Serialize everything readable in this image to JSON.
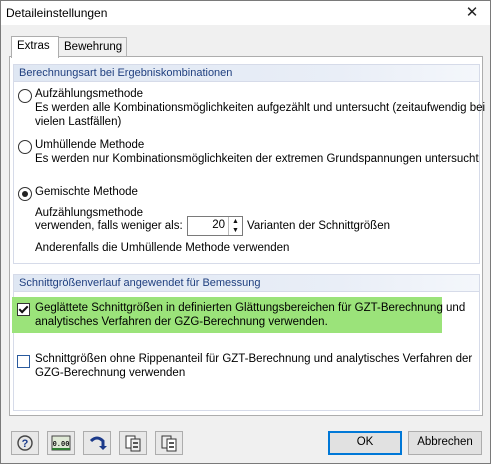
{
  "window": {
    "title": "Detaileinstellungen"
  },
  "tabs": [
    {
      "label": "Extras",
      "active": true
    },
    {
      "label": "Bewehrung",
      "active": false
    }
  ],
  "group1": {
    "title": "Berechnungsart bei Ergebniskombinationen",
    "opt1": {
      "label": "Aufzählungsmethode",
      "desc1": "Es werden alle Kombinationsmöglichkeiten aufgezählt und untersucht (zeitaufwendig bei",
      "desc2": "vielen Lastfällen)"
    },
    "opt2": {
      "label": "Umhüllende Methode",
      "desc1": "Es werden nur Kombinationsmöglichkeiten der extremen Grundspannungen untersucht"
    },
    "opt3": {
      "label": "Gemischte Methode",
      "line1": "Aufzählungsmethode",
      "line2": "verwenden, falls weniger als:",
      "value": "20",
      "after": "Varianten der Schnittgrößen",
      "line3": "Anderenfalls die Umhüllende Methode verwenden"
    }
  },
  "group2": {
    "title": "Schnittgrößenverlauf angewendet für Bemessung",
    "cb1": {
      "line1": "Geglättete Schnittgrößen in definierten Glättungsbereichen für GZT-Berechnung und",
      "line2": "analytisches Verfahren der GZG-Berechnung verwenden.",
      "checked": true
    },
    "cb2": {
      "line1": "Schnittgrößen ohne Rippenanteil für GZT-Berechnung und analytisches Verfahren der",
      "line2": "GZG-Berechnung verwenden",
      "checked": false
    }
  },
  "buttons": {
    "ok": "OK",
    "cancel": "Abbrechen",
    "value_icon_text": "0.00"
  },
  "colors": {
    "highlight": "#9be37a",
    "accent": "#0078d7",
    "group_title": "#1f3f7f"
  }
}
